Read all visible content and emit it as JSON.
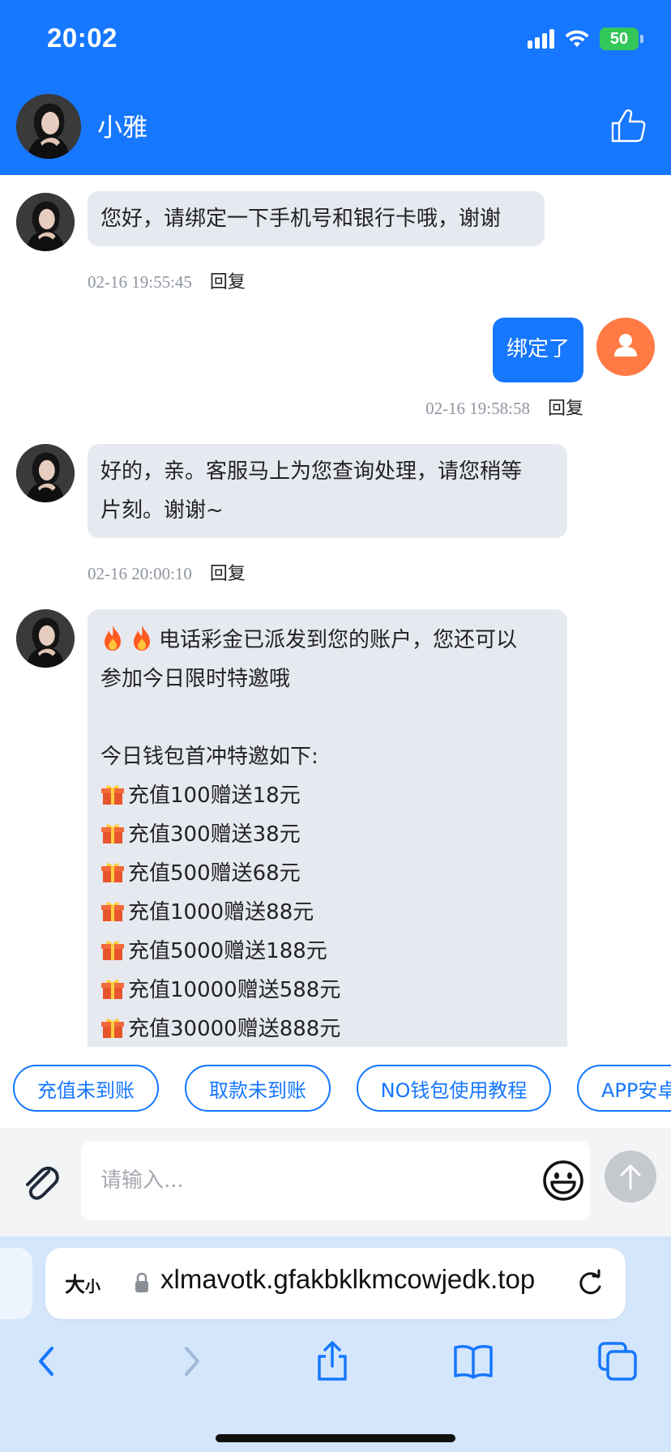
{
  "status_bar": {
    "time": "20:02",
    "battery": "50"
  },
  "header": {
    "name": "小雅"
  },
  "messages": [
    {
      "side": "left",
      "lines": [
        "您好，请绑定一下手机号和银行卡哦，谢谢"
      ],
      "time": "02-16 19:55:45",
      "reply": "回复"
    },
    {
      "side": "right",
      "lines": [
        "绑定了"
      ],
      "time": "02-16 19:58:58",
      "reply": "回复"
    },
    {
      "side": "left",
      "lines": [
        "好的，亲。客服马上为您查询处理，请您稍等",
        "片刻。谢谢~"
      ],
      "time": "02-16 20:00:10",
      "reply": "回复"
    },
    {
      "side": "left",
      "intro": [
        "电话彩金已派发到您的账户，您还可以",
        "参加今日限时特邀哦"
      ],
      "heading": "今日钱包首冲特邀如下:",
      "offers": [
        "充值100赠送18元",
        "充值300赠送38元",
        "充值500赠送68元",
        "充值1000赠送88元",
        "充值5000赠送188元",
        "充值10000赠送588元",
        "充值30000赠送888元"
      ]
    }
  ],
  "quick_replies": [
    "充值未到账",
    "取款未到账",
    "NO钱包使用教程",
    "APP安卓"
  ],
  "input": {
    "placeholder": "请输入..."
  },
  "browser": {
    "text_size_label": "大",
    "text_size_small": "小",
    "url": "xlmavotk.gfakbklkmcowjedk.top"
  },
  "colors": {
    "accent": "#1677ff",
    "bubble_left": "#e6e9f0",
    "user_avatar": "#ff7a45"
  }
}
